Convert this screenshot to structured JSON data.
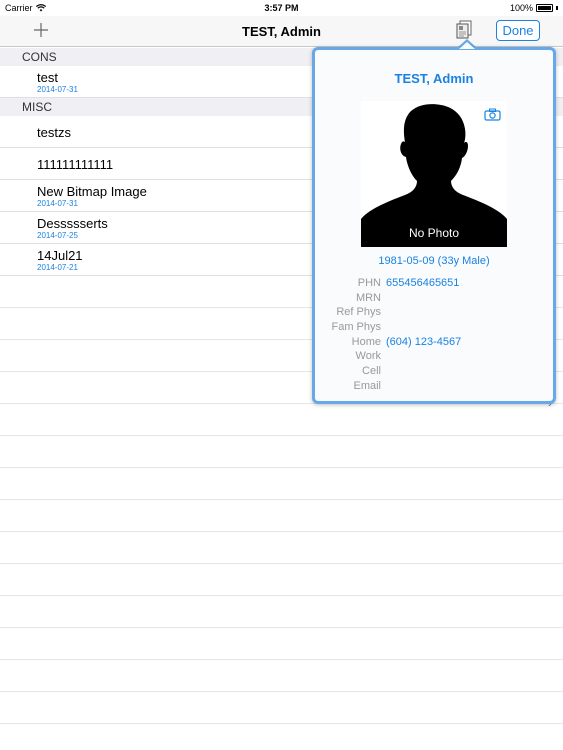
{
  "status": {
    "carrier": "Carrier",
    "time": "3:57 PM",
    "battery": "100%"
  },
  "nav": {
    "add_icon": "plus-icon",
    "title": "TEST, Admin",
    "doc_icon": "document-icon",
    "done_label": "Done"
  },
  "sections": [
    {
      "header": "CONS",
      "rows": [
        {
          "title": "test",
          "date": "2014-07-31"
        }
      ]
    },
    {
      "header": "MISC",
      "rows": [
        {
          "title": "testzs",
          "date": ""
        },
        {
          "title": "111111111111",
          "date": ""
        },
        {
          "title": "New Bitmap Image",
          "date": "2014-07-31"
        },
        {
          "title": "Dessssserts",
          "date": "2014-07-25"
        },
        {
          "title": "14Jul21",
          "date": "2014-07-21"
        }
      ]
    }
  ],
  "popover": {
    "name": "TEST, Admin",
    "photo_label": "No Photo",
    "camera_icon": "camera-icon",
    "dob": "1981-05-09 (33y Male)",
    "fields": [
      {
        "label": "PHN",
        "value": "655456465651"
      },
      {
        "label": "MRN",
        "value": ""
      },
      {
        "label": "Ref Phys",
        "value": ""
      },
      {
        "label": "Fam Phys",
        "value": ""
      },
      {
        "label": "Home",
        "value": "(604) 123-4567"
      },
      {
        "label": "Work",
        "value": ""
      },
      {
        "label": "Cell",
        "value": ""
      },
      {
        "label": "Email",
        "value": ""
      }
    ]
  },
  "colors": {
    "accent": "#1a82e0",
    "popover_border": "#66a8e8",
    "section_bg": "#efeff4"
  }
}
